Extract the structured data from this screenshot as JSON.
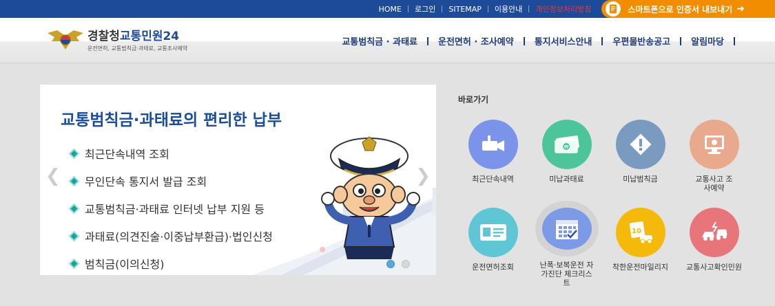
{
  "topbar": {
    "links": [
      "HOME",
      "로그인",
      "SITEMAP",
      "이용안내"
    ],
    "privacy": "개인정보처리방침",
    "smart_button": "스마트폰으로 인증서 내보내기"
  },
  "header": {
    "logo_title_a": "경찰청",
    "logo_title_b": "교통민원24",
    "logo_sub": "운전면허, 교통범칙금·과태료, 교통조사예약",
    "nav": [
      "교통범칙금 · 과태료",
      "운전면허 · 조사예약",
      "통지서비스안내",
      "우편물반송공고",
      "알림마당"
    ]
  },
  "banner": {
    "title": "교통범칙금·과태료의 편리한 납부",
    "items": [
      "최근단속내역 조회",
      "무인단속 통지서 발급 조회",
      "교통범칙금·과태료 인터넷 납부 지원 등",
      "과태료(의견진술·이중납부환급)·법인신청",
      "범칙금(이의신청)"
    ],
    "active_slide": 1,
    "slide_count": 2
  },
  "quick": {
    "title": "바로가기",
    "items": [
      {
        "label": "최근단속내역",
        "icon": "camera-icon",
        "color": "#7b93e8"
      },
      {
        "label": "미납과태료",
        "icon": "money-icon",
        "color": "#4cc59a"
      },
      {
        "label": "미납범칙금",
        "icon": "warning-sign-icon",
        "color": "#7a9bbf"
      },
      {
        "label": "교통사고 조사예약",
        "icon": "computer-icon",
        "color": "#e9a98c"
      },
      {
        "label": "운전면허조회",
        "icon": "license-card-icon",
        "color": "#5fc6d6"
      },
      {
        "label": "난폭·보복운전 자가진단 체크리스트",
        "icon": "calendar-check-icon",
        "color": "#7d9ae6"
      },
      {
        "label": "착한운전마일리지",
        "icon": "mileage-car-icon",
        "color": "#f5b90c"
      },
      {
        "label": "교통사고확인민원",
        "icon": "car-crash-icon",
        "color": "#e8757a"
      }
    ]
  }
}
